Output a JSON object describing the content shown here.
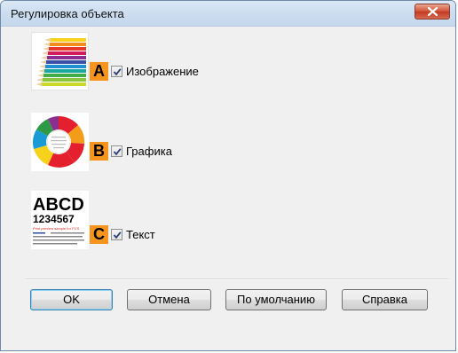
{
  "window": {
    "title": "Регулировка объекта"
  },
  "options": [
    {
      "badge": "A",
      "label": "Изображение",
      "checked": true,
      "thumbnail_icon": "color-pencils-icon"
    },
    {
      "badge": "B",
      "label": "Графика",
      "checked": true,
      "thumbnail_icon": "pie-chart-icon"
    },
    {
      "badge": "C",
      "label": "Текст",
      "checked": true,
      "thumbnail_icon": "text-sample-icon",
      "thumbnail_text": {
        "line1": "ABCD",
        "line2": "1234567",
        "line3": "Print preview sample for F1/S"
      }
    }
  ],
  "buttons": {
    "ok": "OK",
    "cancel": "Отмена",
    "default": "По умолчанию",
    "help": "Справка"
  },
  "colors": {
    "badge": "#f7941d",
    "titlebar": "#cbdcef",
    "close": "#c23a22"
  }
}
